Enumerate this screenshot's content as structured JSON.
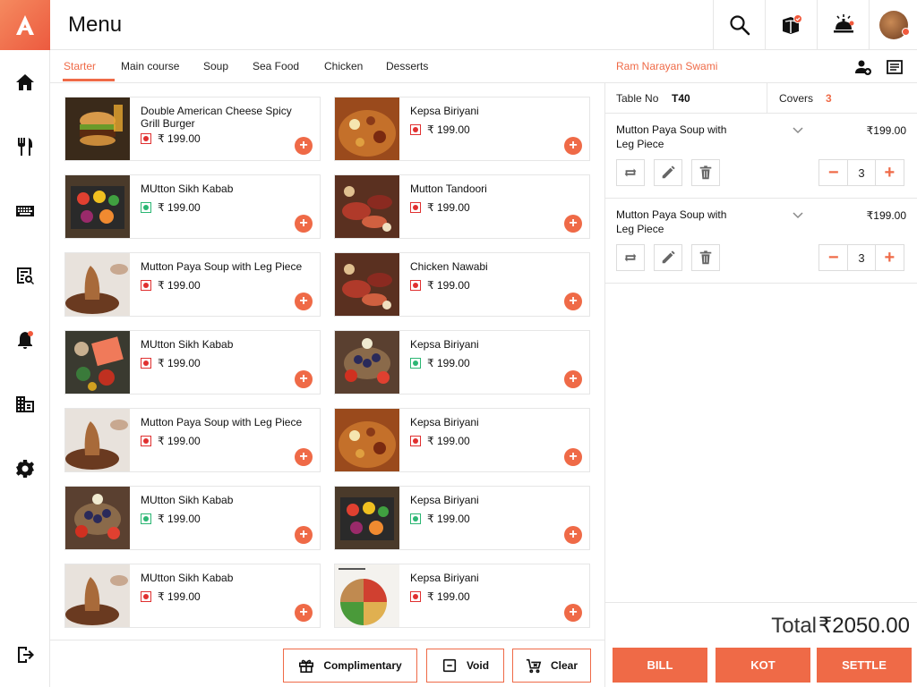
{
  "header": {
    "title": "Menu",
    "icons": [
      "search-icon",
      "box-icon",
      "service-bell-icon",
      "avatar"
    ]
  },
  "sidebar": {
    "icons": [
      "home-icon",
      "cutlery-icon",
      "keyboard-icon",
      "receipt-search-icon",
      "bell-icon",
      "building-icon",
      "gear-icon",
      "logout-icon"
    ]
  },
  "tabs": [
    "Starter",
    "Main course",
    "Soup",
    "Sea Food",
    "Chicken",
    "Desserts"
  ],
  "active_tab": "Starter",
  "menu_items": [
    {
      "name": "Double American Cheese Spicy Grill Burger",
      "price": "₹ 199.00",
      "veg": false,
      "img": "burger"
    },
    {
      "name": "Kepsa Biriyani",
      "price": "₹ 199.00",
      "veg": false,
      "img": "biriyani"
    },
    {
      "name": "MUtton Sikh Kabab",
      "price": "₹ 199.00",
      "veg": true,
      "img": "veggies"
    },
    {
      "name": "Mutton Tandoori",
      "price": "₹ 199.00",
      "veg": false,
      "img": "meats"
    },
    {
      "name": "Mutton Paya Soup with Leg Piece",
      "price": "₹ 199.00",
      "veg": false,
      "img": "soup"
    },
    {
      "name": "Chicken Nawabi",
      "price": "₹ 199.00",
      "veg": false,
      "img": "meats"
    },
    {
      "name": "MUtton Sikh Kabab",
      "price": "₹ 199.00",
      "veg": false,
      "img": "salmon"
    },
    {
      "name": "Kepsa Biriyani",
      "price": "₹ 199.00",
      "veg": true,
      "img": "berries"
    },
    {
      "name": "Mutton Paya Soup with Leg Piece",
      "price": "₹ 199.00",
      "veg": false,
      "img": "soup"
    },
    {
      "name": "Kepsa Biriyani",
      "price": "₹ 199.00",
      "veg": false,
      "img": "biriyani"
    },
    {
      "name": "MUtton Sikh Kabab",
      "price": "₹ 199.00",
      "veg": true,
      "img": "berries"
    },
    {
      "name": "Kepsa Biriyani",
      "price": "₹ 199.00",
      "veg": true,
      "img": "veggies"
    },
    {
      "name": "MUtton Sikh Kabab",
      "price": "₹ 199.00",
      "veg": false,
      "img": "soup"
    },
    {
      "name": "Kepsa Biriyani",
      "price": "₹ 199.00",
      "veg": false,
      "img": "plate"
    }
  ],
  "actions": {
    "complimentary": "Complimentary",
    "void": "Void",
    "clear": "Clear"
  },
  "order": {
    "customer": "Ram Narayan Swami",
    "table_label": "Table No",
    "table_value": "T40",
    "covers_label": "Covers",
    "covers_value": "3",
    "lines": [
      {
        "name": "Mutton Paya Soup with Leg Piece",
        "price": "₹199.00",
        "qty": "3"
      },
      {
        "name": "Mutton Paya Soup with Leg Piece",
        "price": "₹199.00",
        "qty": "3"
      }
    ],
    "total_label": "Total",
    "total_value": "₹2050.00",
    "buttons": {
      "bill": "BILL",
      "kot": "KOT",
      "settle": "SETTLE"
    }
  },
  "colors": {
    "accent": "#ef6a47",
    "veg": "#2bb673",
    "nonveg": "#e03030"
  }
}
